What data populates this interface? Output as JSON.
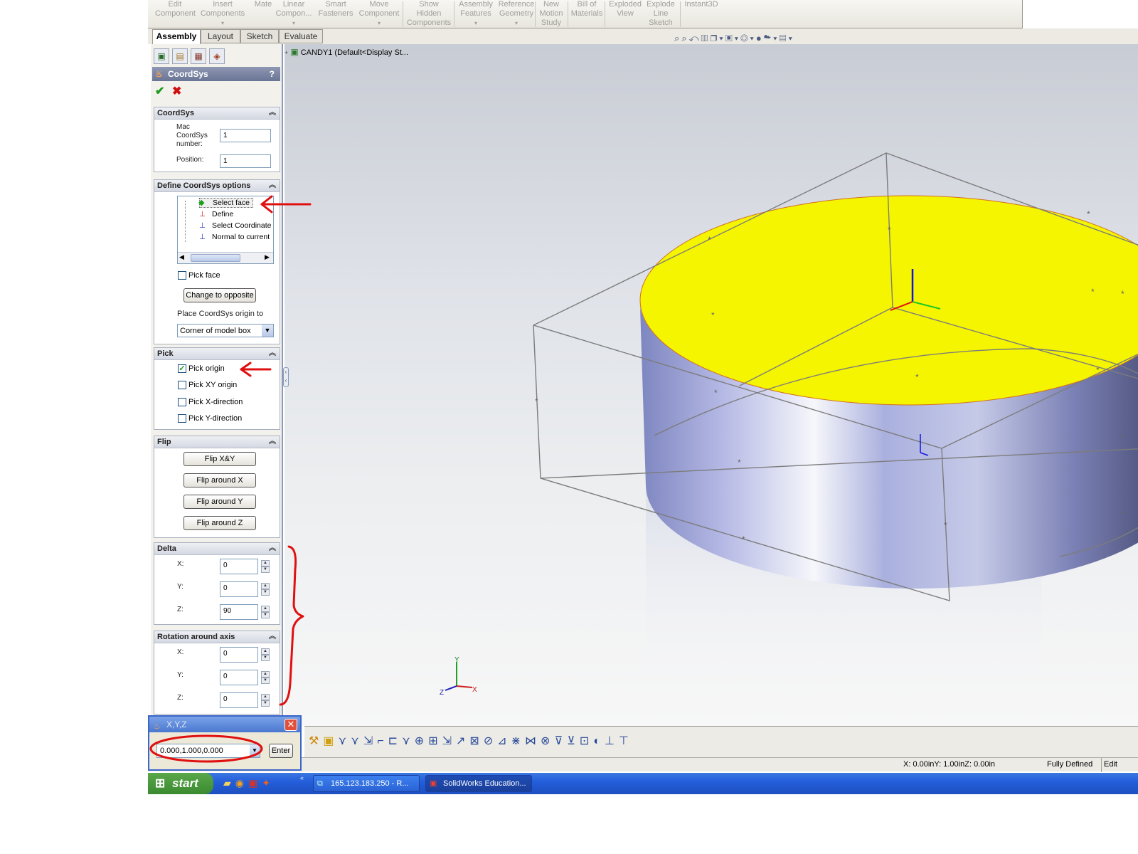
{
  "ribbon": {
    "items": [
      {
        "label": "Edit\nComponent"
      },
      {
        "label": "Insert\nComponents"
      },
      {
        "label": "Mate"
      },
      {
        "label": "Linear\nCompon..."
      },
      {
        "label": "Smart\nFasteners"
      },
      {
        "label": "Move\nComponent"
      },
      {
        "label": "Show\nHidden\nComponents"
      },
      {
        "label": "Assembly\nFeatures"
      },
      {
        "label": "Reference\nGeometry"
      },
      {
        "label": "New\nMotion\nStudy"
      },
      {
        "label": "Bill of\nMaterials"
      },
      {
        "label": "Exploded\nView"
      },
      {
        "label": "Explode\nLine\nSketch"
      },
      {
        "label": "Instant3D"
      }
    ]
  },
  "tabs": [
    "Assembly",
    "Layout",
    "Sketch",
    "Evaluate"
  ],
  "tree": {
    "root": "CANDY1  (Default<Display St..."
  },
  "pm": {
    "title": "CoordSys",
    "help": "?",
    "coordsys": {
      "header": "CoordSys",
      "mac_label": "Mac\nCoordSys\nnumber:",
      "mac_value": "1",
      "pos_label": "Position:",
      "pos_value": "1"
    },
    "define": {
      "header": "Define CoordSys options",
      "items": [
        "Select face",
        "Define",
        "Select Coordinate",
        "Normal to current"
      ],
      "pick_face": "Pick face",
      "change_btn": "Change to opposite",
      "place_label": "Place CoordSys origin to",
      "place_value": "Corner of model box"
    },
    "pick": {
      "header": "Pick",
      "items": [
        {
          "label": "Pick origin",
          "checked": true
        },
        {
          "label": "Pick XY origin",
          "checked": false
        },
        {
          "label": "Pick X-direction",
          "checked": false
        },
        {
          "label": "Pick Y-direction",
          "checked": false
        }
      ]
    },
    "flip": {
      "header": "Flip",
      "buttons": [
        "Flip  X&Y",
        "Flip around X",
        "Flip around Y",
        "Flip around Z"
      ]
    },
    "delta": {
      "header": "Delta",
      "x_label": "X:",
      "x": "0",
      "y_label": "Y:",
      "y": "0",
      "z_label": "Z:",
      "z": "90"
    },
    "rotation": {
      "header": "Rotation around axis",
      "x_label": "X:",
      "x": "0",
      "y_label": "Y:",
      "y": "0",
      "z_label": "Z:",
      "z": "0"
    }
  },
  "xyz": {
    "title": "X,Y,Z",
    "value": "0.000,1.000,0.000",
    "enter": "Enter"
  },
  "status": {
    "coords": "X: 0.00inY: 1.00inZ: 0.00in",
    "state": "Fully Defined",
    "edit": "Edit"
  },
  "triad": {
    "y": "Y",
    "x": "X",
    "z": "Z"
  },
  "taskbar": {
    "start": "start",
    "tasks": [
      "165.123.183.250 - R...",
      "SolidWorks Education..."
    ]
  },
  "colors": {
    "face_top": "#f5f500",
    "cylinder": "#a7acd8",
    "annotation": "#e01010",
    "pm_header": "#6a7494"
  }
}
